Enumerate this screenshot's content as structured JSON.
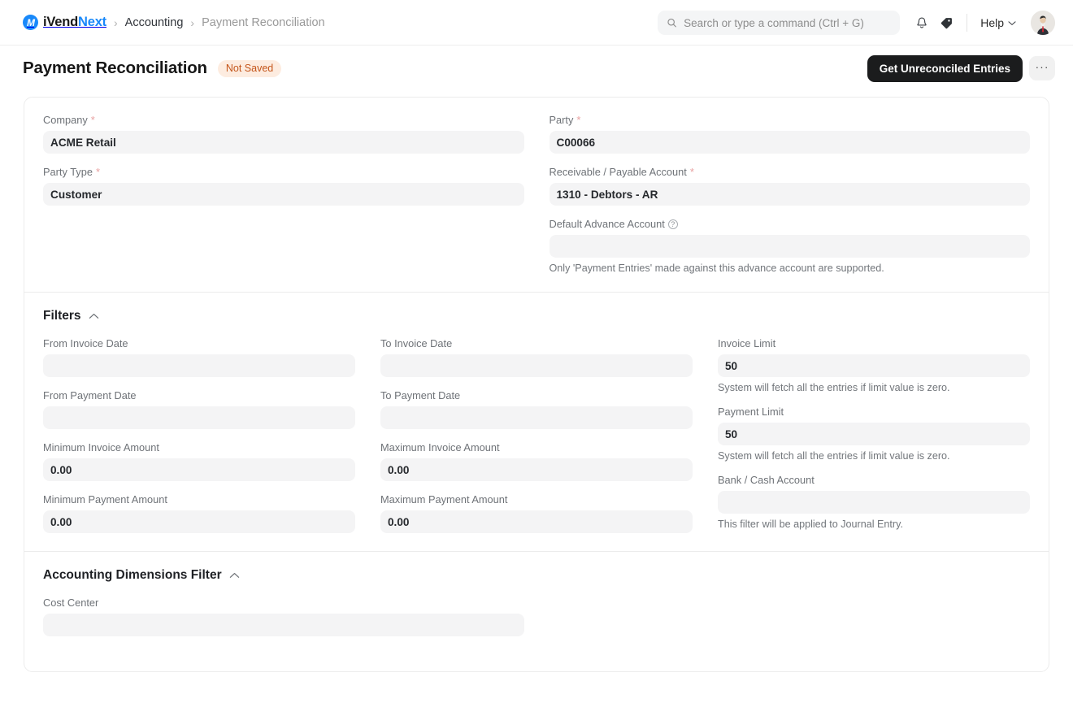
{
  "navbar": {
    "brand_mark": "iv-logo-icon",
    "brand_part1": "iVend",
    "brand_part2": "Next",
    "breadcrumb": [
      {
        "label": "Accounting",
        "muted": false
      },
      {
        "label": "Payment Reconciliation",
        "muted": true
      }
    ],
    "separator": "›",
    "search": {
      "placeholder": "Search or type a command (Ctrl + G)",
      "value": "",
      "icon": "search-icon"
    },
    "notification_icon": "bell-icon",
    "tag_icon": "tag-icon",
    "help_label": "Help",
    "help_chevron": "chevron-down-icon",
    "avatar": "user-avatar"
  },
  "page_header": {
    "title": "Payment Reconciliation",
    "status_badge": "Not Saved",
    "primary_button": "Get Unreconciled Entries",
    "more_button": "···"
  },
  "details": {
    "company": {
      "label": "Company",
      "required": true,
      "value": "ACME Retail"
    },
    "party_type": {
      "label": "Party Type",
      "required": true,
      "value": "Customer"
    },
    "party": {
      "label": "Party",
      "required": true,
      "value": "C00066"
    },
    "receivable_payable_account": {
      "label": "Receivable / Payable Account",
      "required": true,
      "value": "1310 - Debtors - AR"
    },
    "default_advance_account": {
      "label": "Default Advance Account",
      "required": false,
      "value": "",
      "help_icon": "question-circle-icon",
      "hint": "Only 'Payment Entries' made against this advance account are supported."
    }
  },
  "filters": {
    "title": "Filters",
    "collapse_icon": "chevron-up-icon",
    "from_invoice_date": {
      "label": "From Invoice Date",
      "value": ""
    },
    "to_invoice_date": {
      "label": "To Invoice Date",
      "value": ""
    },
    "invoice_limit": {
      "label": "Invoice Limit",
      "value": "50",
      "hint": "System will fetch all the entries if limit value is zero."
    },
    "from_payment_date": {
      "label": "From Payment Date",
      "value": ""
    },
    "to_payment_date": {
      "label": "To Payment Date",
      "value": ""
    },
    "payment_limit": {
      "label": "Payment Limit",
      "value": "50",
      "hint": "System will fetch all the entries if limit value is zero."
    },
    "minimum_invoice_amount": {
      "label": "Minimum Invoice Amount",
      "value": "0.00"
    },
    "maximum_invoice_amount": {
      "label": "Maximum Invoice Amount",
      "value": "0.00"
    },
    "bank_cash_account": {
      "label": "Bank / Cash Account",
      "value": "",
      "hint": "This filter will be applied to Journal Entry."
    },
    "minimum_payment_amount": {
      "label": "Minimum Payment Amount",
      "value": "0.00"
    },
    "maximum_payment_amount": {
      "label": "Maximum Payment Amount",
      "value": "0.00"
    }
  },
  "accounting_dimensions": {
    "title": "Accounting Dimensions Filter",
    "collapse_icon": "chevron-up-icon",
    "cost_center": {
      "label": "Cost Center",
      "value": ""
    }
  },
  "colors": {
    "brand_blue": "#1989fa",
    "badge_bg": "#fdece0",
    "badge_text": "#c4551a",
    "primary_button_bg": "#1b1c1d",
    "input_bg": "#f4f4f5",
    "required_star": "#e8a0a0"
  }
}
